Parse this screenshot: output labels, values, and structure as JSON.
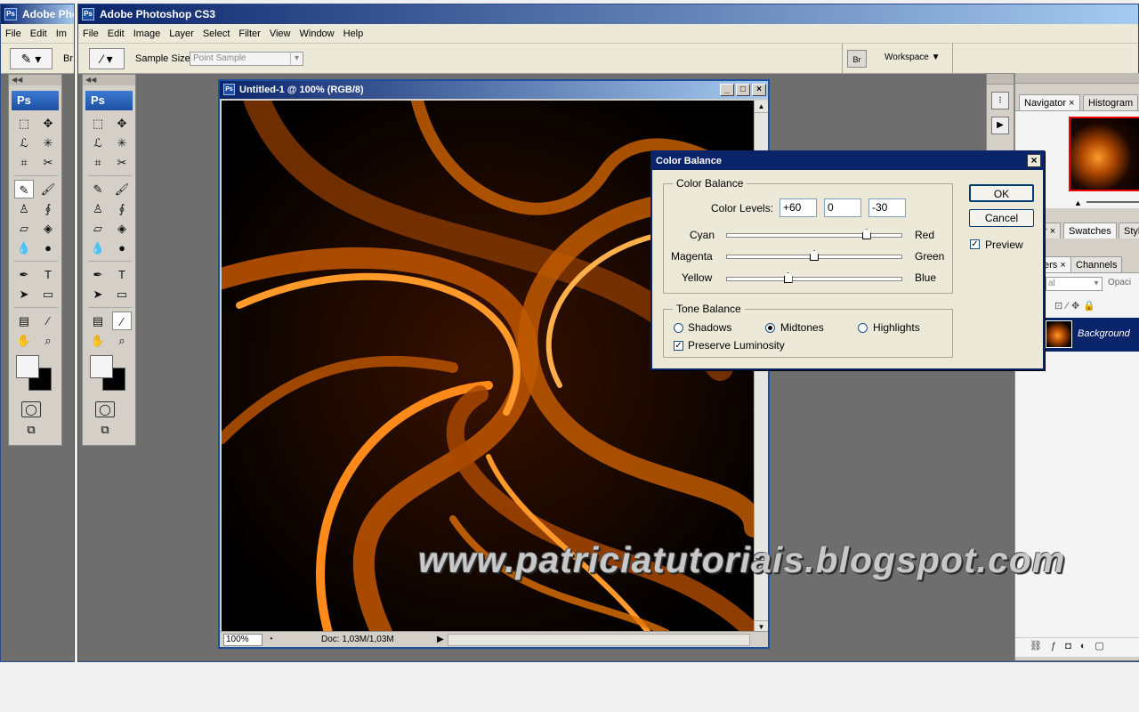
{
  "back_window": {
    "title": "Adobe Phot",
    "menu": [
      "File",
      "Edit",
      "Im"
    ],
    "options_label": "Br"
  },
  "front_window": {
    "title": "Adobe Photoshop CS3",
    "menu": [
      "File",
      "Edit",
      "Image",
      "Layer",
      "Select",
      "Filter",
      "View",
      "Window",
      "Help"
    ],
    "options": {
      "sample_size_label": "Sample Size:",
      "sample_size_value": "Point Sample",
      "workspace_label": "Workspace ▼",
      "bridge_icon_text": "Br"
    }
  },
  "toolbox": {
    "logo": "Ps",
    "tools": [
      "marquee-tool",
      "move-tool",
      "lasso-tool",
      "magic-wand-tool",
      "crop-tool",
      "slice-tool",
      "healing-brush-tool",
      "brush-tool",
      "clone-stamp-tool",
      "history-brush-tool",
      "eraser-tool",
      "paint-bucket-tool",
      "blur-tool",
      "dodge-tool",
      "pen-tool",
      "type-tool",
      "path-selection-tool",
      "shape-tool",
      "notes-tool",
      "eyedropper-tool",
      "hand-tool",
      "zoom-tool"
    ]
  },
  "document": {
    "title": "Untitled-1 @ 100% (RGB/8)",
    "zoom": "100%",
    "doc_size": "Doc: 1,03M/1,03M"
  },
  "panels": {
    "navigator_tabs": [
      "Navigator",
      "Histogram"
    ],
    "swatch_tabs": [
      "r",
      "Swatches",
      "Styl"
    ],
    "layer_tabs": [
      "ers",
      "Channels"
    ],
    "blend_mode": "al",
    "opacity_label": "Opaci",
    "layer_name": "Background"
  },
  "dialog": {
    "title": "Color Balance",
    "group_color_balance": "Color Balance",
    "color_levels_label": "Color Levels:",
    "levels": [
      "+60",
      "0",
      "-30"
    ],
    "sliders": [
      {
        "left": "Cyan",
        "right": "Red",
        "value": 60
      },
      {
        "left": "Magenta",
        "right": "Green",
        "value": 0
      },
      {
        "left": "Yellow",
        "right": "Blue",
        "value": -30
      }
    ],
    "group_tone": "Tone Balance",
    "tones": [
      "Shadows",
      "Midtones",
      "Highlights"
    ],
    "selected_tone": "Midtones",
    "preserve_luminosity": "Preserve Luminosity",
    "preserve_checked": true,
    "ok": "OK",
    "cancel": "Cancel",
    "preview": "Preview",
    "preview_checked": true
  },
  "watermark": "www.patriciatutoriais.blogspot.com"
}
